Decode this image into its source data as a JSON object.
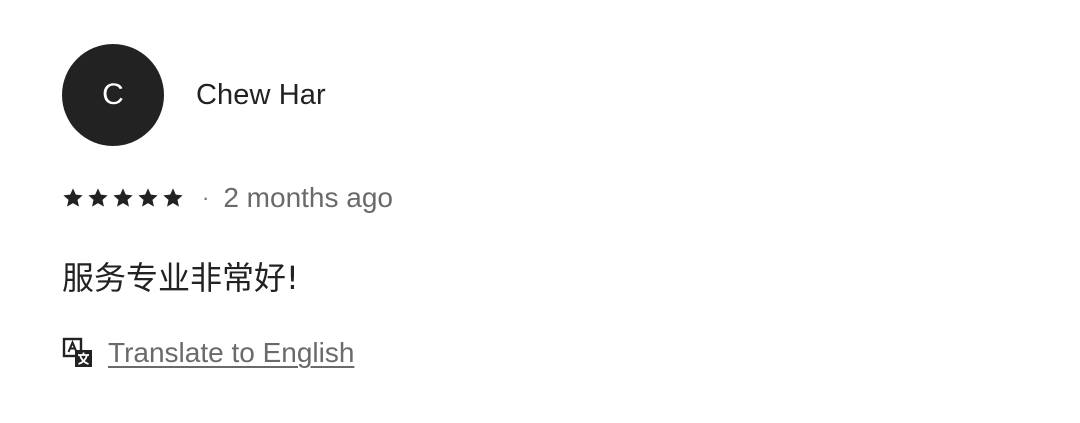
{
  "review": {
    "avatar_initial": "C",
    "reviewer_name": "Chew Har",
    "rating": 5,
    "rating_max": 5,
    "separator": "·",
    "date": "2 months ago",
    "text": "服务专业非常好!",
    "translate_label": "Translate to English",
    "translate_icon": "translate-icon",
    "star_icon": "star-icon"
  },
  "colors": {
    "text_primary": "#222222",
    "text_secondary": "#6a6a6a",
    "avatar_bg": "#222222",
    "avatar_fg": "#ffffff"
  }
}
